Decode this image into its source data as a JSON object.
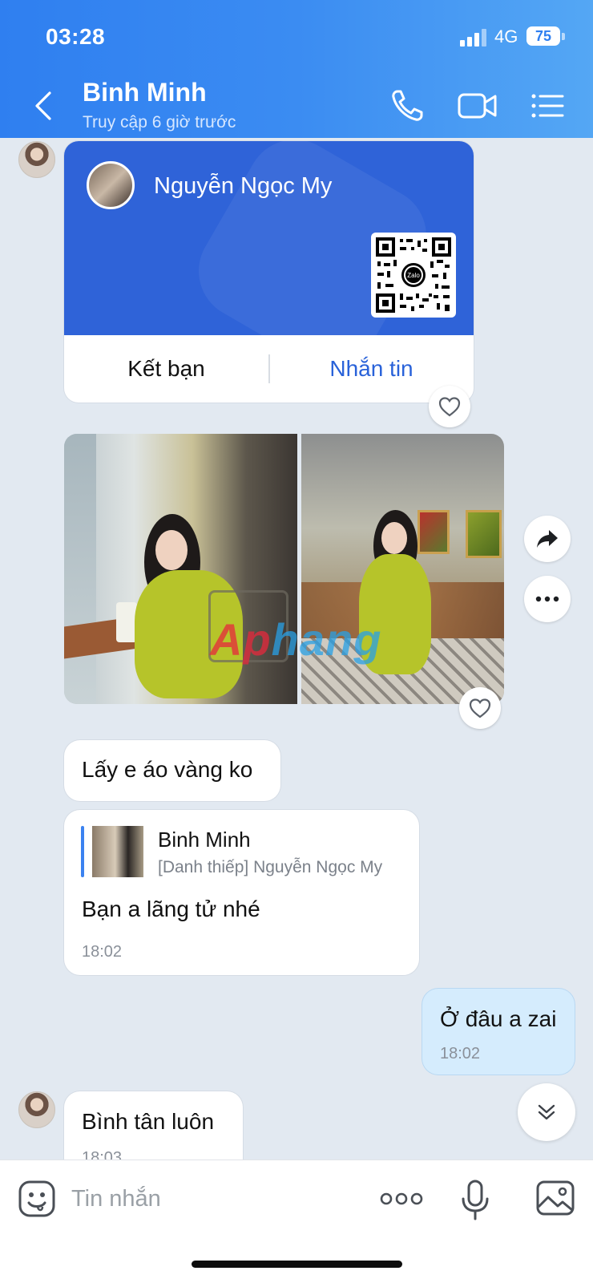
{
  "status_bar": {
    "time": "03:28",
    "network": "4G",
    "battery": "75"
  },
  "header": {
    "name": "Binh Minh",
    "status": "Truy cập 6 giờ trước"
  },
  "card": {
    "name": "Nguyễn Ngọc My",
    "add_friend": "Kết bạn",
    "message": "Nhắn tin",
    "qr_logo": "Zalo"
  },
  "watermark": {
    "part1": "Ap",
    "part2": "hang"
  },
  "messages": {
    "m1": {
      "text": "Lấy e áo vàng ko"
    },
    "m2": {
      "quote_name": "Binh Minh",
      "quote_sub": "[Danh thiếp] Nguyễn Ngọc My",
      "text": "Bạn a lãng tử nhé",
      "time": "18:02"
    },
    "m3": {
      "text": "Ở đâu a zai",
      "time": "18:02"
    },
    "m4": {
      "text": "Bình tân luôn",
      "time": "18:03"
    }
  },
  "input": {
    "placeholder": "Tin nhắn"
  },
  "colors": {
    "header_start": "#2f7ff0",
    "header_end": "#54a7f4",
    "card_blue": "#2f63d8",
    "link_blue": "#2962d9",
    "own_bubble": "#d5ecfd",
    "background": "#e2e9f1"
  },
  "icons": [
    "back-icon",
    "phone-icon",
    "video-icon",
    "menu-icon",
    "heart-icon",
    "share-icon",
    "more-icon",
    "chevron-down-icon",
    "emoji-icon",
    "dots-icon",
    "mic-icon",
    "image-icon"
  ]
}
